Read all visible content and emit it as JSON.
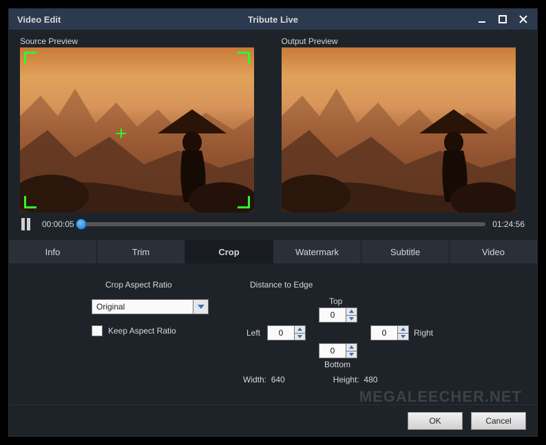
{
  "titlebar": {
    "app_name": "Video Edit",
    "window_title": "Tribute Live"
  },
  "previews": {
    "source_label": "Source Preview",
    "output_label": "Output Preview"
  },
  "timeline": {
    "current": "00:00:05",
    "total": "01:24:56"
  },
  "tabs": {
    "info": "Info",
    "trim": "Trim",
    "crop": "Crop",
    "watermark": "Watermark",
    "subtitle": "Subtitle",
    "video": "Video"
  },
  "crop_panel": {
    "aspect_ratio_label": "Crop Aspect Ratio",
    "aspect_ratio_value": "Original",
    "keep_aspect_label": "Keep Aspect Ratio",
    "distance_label": "Distance to Edge",
    "top_label": "Top",
    "left_label": "Left",
    "right_label": "Right",
    "bottom_label": "Bottom",
    "top_value": "0",
    "left_value": "0",
    "right_value": "0",
    "bottom_value": "0",
    "width_label": "Width:",
    "width_value": "640",
    "height_label": "Height:",
    "height_value": "480"
  },
  "footer": {
    "ok": "OK",
    "cancel": "Cancel"
  },
  "watermark_text": "MEGALEECHER.NET"
}
